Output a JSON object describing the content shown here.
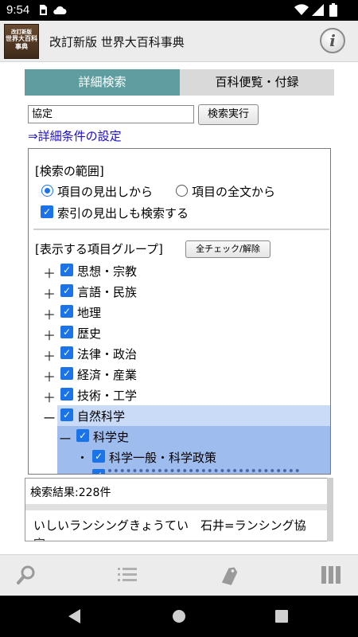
{
  "status_bar": {
    "time": "9:54"
  },
  "header": {
    "logo_lines": [
      "改訂新版",
      "世界大百科",
      "事典"
    ],
    "title": "改訂新版 世界大百科事典",
    "info_glyph": "i"
  },
  "tabs": [
    {
      "label": "詳細検索",
      "active": true
    },
    {
      "label": "百科便覧・付録",
      "active": false
    }
  ],
  "search": {
    "value": "協定",
    "button": "検索実行"
  },
  "detail_link": "⇒詳細条件の設定",
  "scope": {
    "heading": "[検索の範囲]",
    "radio_headword": "項目の見出しから",
    "radio_fulltext": "項目の全文から",
    "selected": "headword",
    "index_checkbox": "索引の見出しも検索する"
  },
  "groups": {
    "heading": "[表示する項目グループ]",
    "all_check_button": "全チェック/解除",
    "items": [
      "思想・宗教",
      "言語・民族",
      "地理",
      "歴史",
      "法律・政治",
      "経済・産業",
      "技術・工学",
      "自然科学"
    ],
    "expanded_child": "科学史",
    "grandchild": "科学一般・科学政策",
    "expand_symbol": "＋",
    "collapse_symbol": "ー",
    "bullet": "・"
  },
  "results": {
    "count": "検索結果:228件",
    "first_row": "いしいランシングきょうてい　石井=ランシング協",
    "second_row": "定"
  },
  "colors": {
    "accent_tab": "#5e9ea0",
    "checkbox": "#1a73e8",
    "link": "#1a0dcc",
    "highlight": "#c9dbf7",
    "highlight_selected": "#9fbcee"
  }
}
